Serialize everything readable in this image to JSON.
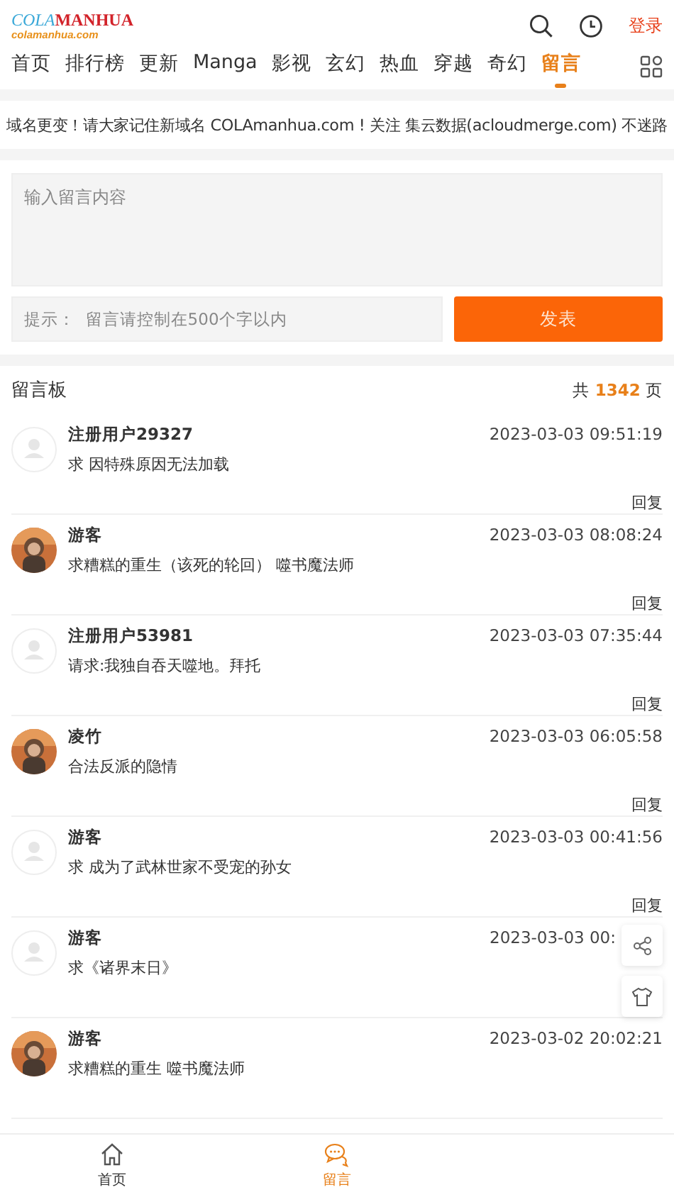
{
  "header": {
    "logo": {
      "part_1": "COLA",
      "part_2": "MANHUA",
      "subtitle": "colamanhua.com"
    },
    "login": "登录"
  },
  "nav_tabs": [
    {
      "label": "首页",
      "selected": false
    },
    {
      "label": "排行榜",
      "selected": false
    },
    {
      "label": "更新",
      "selected": false
    },
    {
      "label": "Manga",
      "selected": false
    },
    {
      "label": "影视",
      "selected": false
    },
    {
      "label": "玄幻",
      "selected": false
    },
    {
      "label": "热血",
      "selected": false
    },
    {
      "label": "穿越",
      "selected": false
    },
    {
      "label": "奇幻",
      "selected": false
    },
    {
      "label": "留言",
      "selected": true
    }
  ],
  "notice": "域名更变！请大家记住新域名 COLAmanhua.com ! 关注 集云数据(acloudmerge.com) 不迷路",
  "form": {
    "message_placeholder": "输入留言内容",
    "hint_placeholder": "提示：  留言请控制在500个字以内",
    "submit": "发表"
  },
  "board": {
    "title": "留言板",
    "pages_prefix": "共",
    "pages_count": "1342",
    "pages_suffix": "页"
  },
  "messages": [
    {
      "avatar": {
        "kind": "default"
      },
      "user": "注册用户29327",
      "time": "2023-03-03 09:51:19",
      "text": "求 因特殊原因无法加载",
      "reply": "回复"
    },
    {
      "user": "游客",
      "time": "2023-03-03 08:08:24",
      "text": "求糟糕的重生（该死的轮回） 噬书魔法师",
      "reply": "回复"
    },
    {
      "avatar": {
        "kind": "default"
      },
      "user": "注册用户53981",
      "time": "2023-03-03 07:35:44",
      "text": "请求:我独自吞天噬地。拜托",
      "reply": "回复"
    },
    {
      "user": "凌竹",
      "time": "2023-03-03 06:05:58",
      "text": "合法反派的隐情",
      "reply": "回复"
    },
    {
      "avatar": {
        "kind": "default"
      },
      "user": "游客",
      "time": "2023-03-03 00:41:56",
      "text": "求 成为了武林世家不受宠的孙女",
      "reply": "回复"
    },
    {
      "avatar": {
        "kind": "default"
      },
      "user": "游客",
      "time": "2023-03-03 00:",
      "text": "求《诸界末日》"
    },
    {
      "user": "游客",
      "time": "2023-03-02 20:02:21",
      "text": "求糟糕的重生 噬书魔法师"
    }
  ],
  "bottom_nav": [
    {
      "label": "首页",
      "kind": "home",
      "selected": false
    },
    {
      "label": "留言",
      "kind": "chat",
      "selected": true
    }
  ]
}
